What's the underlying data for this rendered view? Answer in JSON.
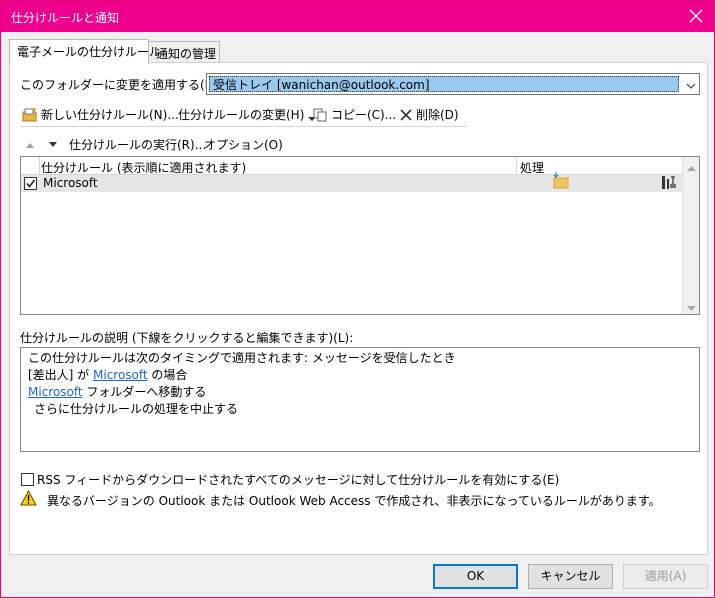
{
  "window": {
    "title": "仕分けルールと通知"
  },
  "tabs": [
    {
      "label": "電子メールの仕分けルール"
    },
    {
      "label": "通知の管理"
    }
  ],
  "folder": {
    "label": "このフォルダーに変更を適用する(F):",
    "value": "受信トレイ [wanichan@outlook.com]"
  },
  "toolbar": {
    "new_rule": "新しい仕分けルール(N)...",
    "change_rule": "仕分けルールの変更(H)",
    "copy": "コピー(C)...",
    "delete": "削除(D)",
    "run_rules": "仕分けルールの実行(R)...",
    "options": "オプション(O)"
  },
  "rules_table": {
    "headers": [
      "仕分けルール (表示順に適用されます)",
      "処理"
    ],
    "rows": [
      {
        "name": "Microsoft",
        "enabled": true
      }
    ]
  },
  "description": {
    "label": "仕分けルールの説明 (下線をクリックすると編集できます)(L):",
    "line1": "この仕分けルールは次のタイミングで適用されます: メッセージを受信したとき",
    "line2_prefix": "[差出人] が ",
    "line2_link": "Microsoft",
    "line2_suffix": " の場合",
    "line3_link": "Microsoft",
    "line3_suffix": " フォルダーへ移動する",
    "line4": "さらに仕分けルールの処理を中止する"
  },
  "rss_option": {
    "label": "RSS フィードからダウンロードされたすべてのメッセージに対して仕分けルールを有効にする(E)",
    "checked": false
  },
  "warning": {
    "text": "異なるバージョンの Outlook または Outlook Web Access で作成され、非表示になっているルールがあります。"
  },
  "buttons": {
    "ok": "OK",
    "cancel": "キャンセル",
    "apply": "適用(A)"
  },
  "colors": {
    "titlebar": "#ec008c",
    "selection": "#99c9ef",
    "link": "#2167c6",
    "default_button_border": "#0078d7"
  }
}
